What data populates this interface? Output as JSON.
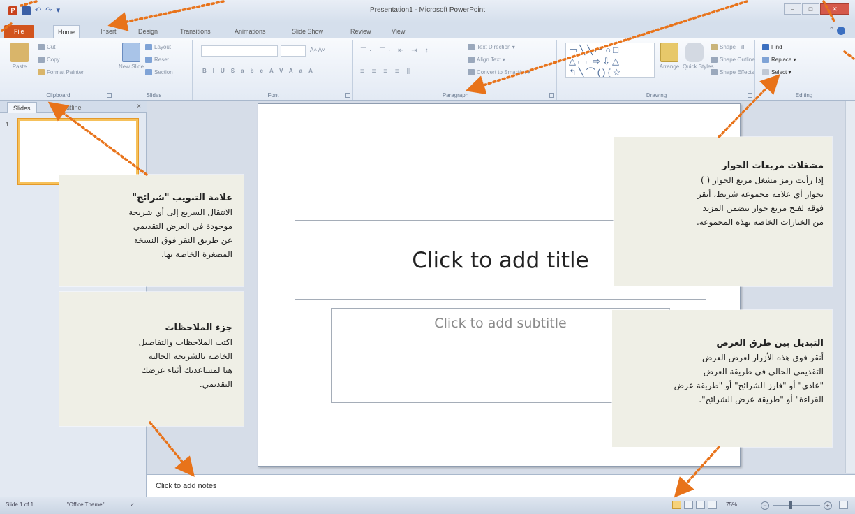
{
  "window": {
    "title": "Presentation1 - Microsoft PowerPoint",
    "app_icon_letter": "P"
  },
  "tabs": [
    "File",
    "Home",
    "Insert",
    "Design",
    "Transitions",
    "Animations",
    "Slide Show",
    "Review",
    "View"
  ],
  "active_tab": "Home",
  "ribbon": {
    "clipboard": {
      "label": "Clipboard",
      "paste": "Paste",
      "cut": "Cut",
      "copy": "Copy",
      "format_painter": "Format Painter"
    },
    "slides": {
      "label": "Slides",
      "new_slide": "New Slide",
      "layout": "Layout",
      "reset": "Reset",
      "section": "Section"
    },
    "font": {
      "label": "Font",
      "buttons": [
        "B",
        "I",
        "U",
        "S",
        "abc",
        "AV",
        "Aa",
        "A"
      ]
    },
    "paragraph": {
      "label": "Paragraph",
      "text_direction": "Text Direction",
      "align_text": "Align Text",
      "convert_smartart": "Convert to SmartArt"
    },
    "drawing": {
      "label": "Drawing",
      "arrange": "Arrange",
      "quick_styles": "Quick Styles",
      "shape_fill": "Shape Fill",
      "shape_outline": "Shape Outline",
      "shape_effects": "Shape Effects"
    },
    "editing": {
      "label": "Editing",
      "find": "Find",
      "replace": "Replace",
      "select": "Select"
    }
  },
  "left_pane": {
    "tabs": [
      "Slides",
      "Outline"
    ],
    "close": "×",
    "slide_number": "1"
  },
  "slide": {
    "title_placeholder": "Click to add title",
    "subtitle_placeholder": "Click to add subtitle"
  },
  "notes": {
    "placeholder": "Click to add notes"
  },
  "statusbar": {
    "slide_info": "Slide 1 of 1",
    "theme": "\"Office Theme\"",
    "zoom": "75%"
  },
  "callouts": {
    "dialog_launchers": {
      "title": "مشغلات مربعات الحوار",
      "lines": [
        "إذا رأيت رمز مشغل مربع الحوار ( )",
        "بجوار أي علامة مجموعة شريط، أنقر",
        "فوقه لفتح مربع حوار يتضمن المزيد",
        "من الخيارات الخاصة بهذه المجموعة."
      ]
    },
    "slides_tab": {
      "title": "علامة التبويب \"شرائح\"",
      "lines": [
        "الانتقال السريع إلى أي شريحة",
        "موجودة في العرض التقديمي",
        "عن طريق النقر فوق النسخة",
        "المصغرة الخاصة بها."
      ]
    },
    "notes_pane": {
      "title": "جزء الملاحظات",
      "lines": [
        "اكتب الملاحظات والتفاصيل",
        "الخاصة بالشريحة الحالية",
        "هنا لمساعدتك أثناء عرضك",
        "التقديمي."
      ]
    },
    "view_switch": {
      "title": "التبديل بين طرق العرض",
      "lines": [
        "أنقر فوق هذه الأزرار لعرض العرض",
        "التقديمي الحالي في طريقة العرض",
        "\"عادي\" أو \"فارز الشرائح\" أو \"طريقة عرض",
        "القراءة\" أو \"طريقة عرض الشرائح\"."
      ]
    }
  },
  "colors": {
    "accent_orange": "#e8731a",
    "file_tab": "#d2541d",
    "ribbon_bg": "#eef2f8",
    "callout_bg": "#efefe6"
  }
}
